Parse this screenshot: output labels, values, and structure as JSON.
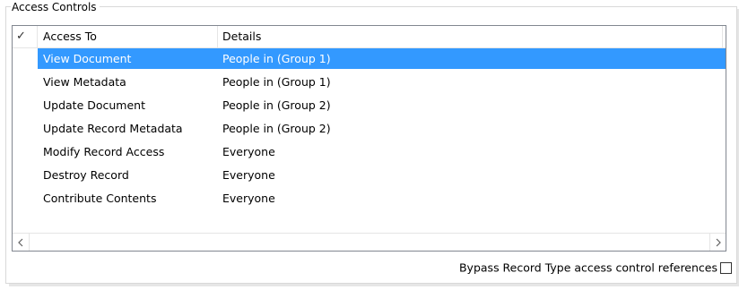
{
  "group": {
    "title": "Access Controls"
  },
  "list": {
    "columns": {
      "check": "✓",
      "access_to": "Access To",
      "details": "Details"
    },
    "rows": [
      {
        "access_to": "View Document",
        "details": "People in (Group 1)",
        "selected": true
      },
      {
        "access_to": "View Metadata",
        "details": "People in (Group 1)",
        "selected": false
      },
      {
        "access_to": "Update Document",
        "details": "People in (Group 2)",
        "selected": false
      },
      {
        "access_to": "Update Record Metadata",
        "details": "People in (Group 2)",
        "selected": false
      },
      {
        "access_to": "Modify Record Access",
        "details": "Everyone",
        "selected": false
      },
      {
        "access_to": "Destroy Record",
        "details": "Everyone",
        "selected": false
      },
      {
        "access_to": "Contribute Contents",
        "details": "Everyone",
        "selected": false
      }
    ],
    "scrollbar": {
      "left_icon": "chevron-left-icon",
      "right_icon": "chevron-right-icon"
    }
  },
  "bypass": {
    "label": "Bypass Record Type access control references",
    "checked": false
  },
  "colors": {
    "selection": "#3399ff",
    "list_border": "#828790"
  }
}
